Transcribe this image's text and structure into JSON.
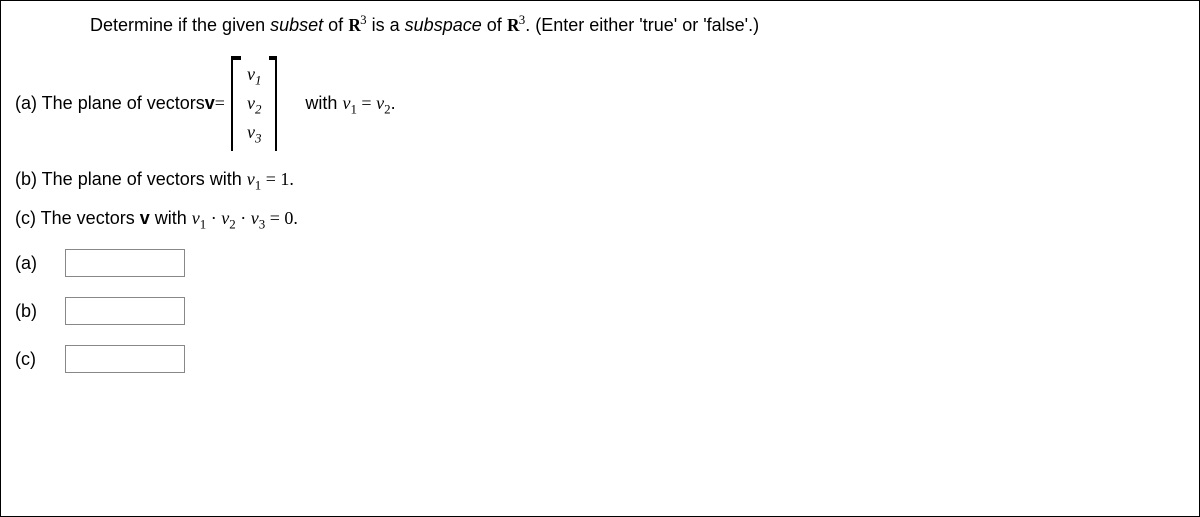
{
  "question": {
    "pre": "Determine if the given ",
    "subset": "subset",
    "mid1": " of ",
    "r3a": "R",
    "exp1": "3",
    "mid2": " is a ",
    "subspace": "subspace",
    "mid3": " of ",
    "r3b": "R",
    "exp2": "3",
    "tail": ".  (Enter either 'true' or 'false'.)"
  },
  "partA": {
    "label": "(a) The plane of vectors ",
    "vec": "v",
    "eq": " = ",
    "m1": "v",
    "m1s": "1",
    "m2": "v",
    "m2s": "2",
    "m3": "v",
    "m3s": "3",
    "with": "with ",
    "lhs": "v",
    "lhss": "1",
    "eqs": " = ",
    "rhs": "v",
    "rhss": "2",
    "dot": "."
  },
  "partB": {
    "label": "(b) The plane of vectors with ",
    "v": "v",
    "vs": "1",
    "eq": " = ",
    "val": "1.",
    "valnum": "1"
  },
  "partC": {
    "label": "(c) The vectors ",
    "vec": "v",
    "with": " with ",
    "v1": "v",
    "v1s": "1",
    "d1": " · ",
    "v2": "v",
    "v2s": "2",
    "d2": " · ",
    "v3": "v",
    "v3s": "3",
    "eq": " = ",
    "val": "0."
  },
  "answers": {
    "a": "(a)",
    "b": "(b)",
    "c": "(c)"
  }
}
